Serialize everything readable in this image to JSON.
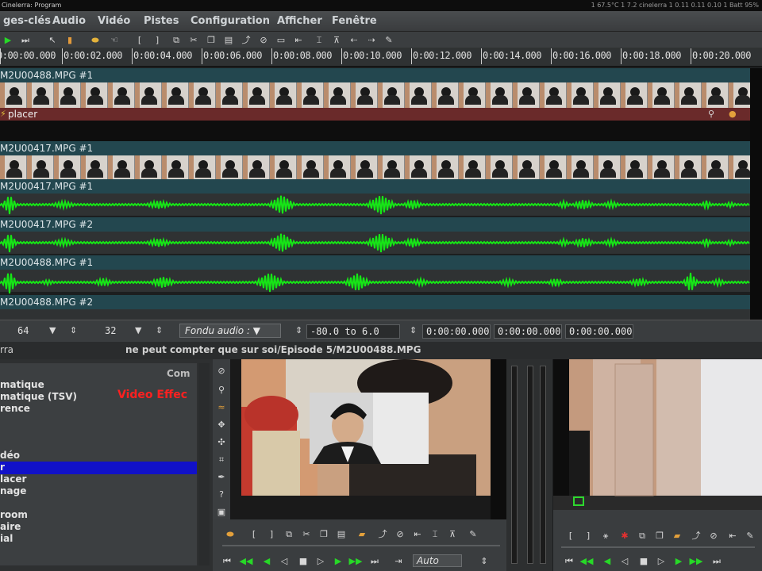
{
  "window": {
    "title": "Cinelerra: Program",
    "status": "1 67.5°C  1 7.2  cinelerra  1 0.11  0.11 0.10  1  Batt 95%"
  },
  "menu": [
    "ges-clés",
    "Audio",
    "Vidéo",
    "Pistes",
    "Configuration",
    "Afficher",
    "Fenêtre"
  ],
  "toolbar_icons": [
    "play-icon",
    "skip-icon",
    "arrow-icon",
    "cursor-icon",
    "label-icon",
    "hand-icon",
    "in-point-icon",
    "out-point-icon",
    "cut-icon",
    "delete-icon",
    "copy-icon",
    "paste-icon",
    "splice-icon",
    "overwrite-icon",
    "clip-icon",
    "lift-icon",
    "extract-icon",
    "mark-icon",
    "prev-label-icon",
    "next-label-icon",
    "tools-icon"
  ],
  "ruler": {
    "labels": [
      "0:00:00.000",
      "0:00:02.000",
      "0:00:04.000",
      "0:00:06.000",
      "0:00:08.000",
      "0:00:10.000",
      "0:00:12.000",
      "0:00:14.000",
      "0:00:16.000",
      "0:00:18.000",
      "0:00:20.000"
    ]
  },
  "tracks": {
    "v1_title": "M2U00488.MPG #1",
    "transition_label": "placer",
    "v2_title": "M2U00417.MPG #1",
    "a1_title": "M2U00417.MPG #1",
    "a2_title": "M2U00417.MPG #2",
    "a3_title": "M2U00488.MPG #1",
    "a4_title": "M2U00488.MPG #2"
  },
  "controls": {
    "value_a": "64",
    "value_b": "32",
    "fade_label": "Fondu audio : ▼",
    "range": "-80.0 to 6.0",
    "tc1": "0:00:00.000",
    "tc2": "0:00:00.000",
    "tc3": "0:00:00.000"
  },
  "lower": {
    "left_title": "rra",
    "center_title": "ne peut compter que sur soi/Episode 5/M2U00488.MPG"
  },
  "effects": {
    "header": "Com",
    "video_label": "Video Effec",
    "items": [
      "matique",
      "matique (TSV)",
      "rence",
      "",
      "",
      "déo",
      "r",
      "lacer",
      "nage",
      "",
      "room",
      "aire",
      "ial"
    ],
    "selected_index": 6
  },
  "compositor": {
    "zoom": "Auto"
  },
  "colors": {
    "waveform": "#16e616",
    "track_header": "#23474f",
    "selection": "#1111c8",
    "effect_label": "#ff2020"
  }
}
